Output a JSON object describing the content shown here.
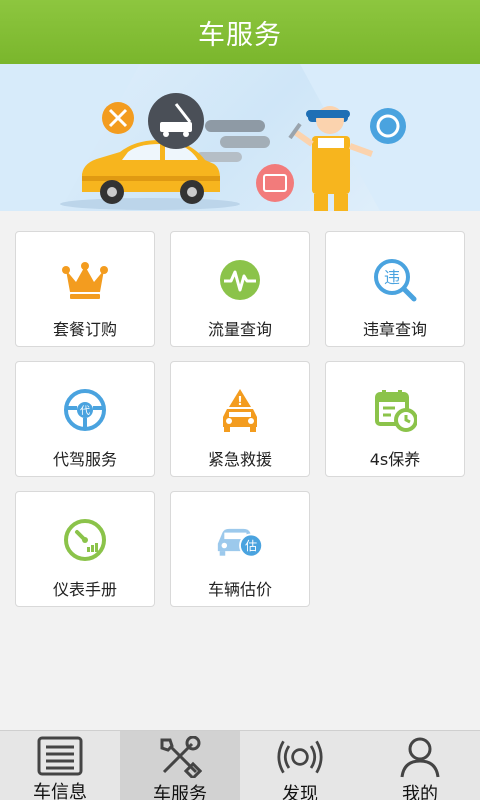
{
  "header": {
    "title": "车服务"
  },
  "services": [
    {
      "label": "套餐订购",
      "icon": "crown-icon"
    },
    {
      "label": "流量查询",
      "icon": "pulse-icon"
    },
    {
      "label": "违章查询",
      "icon": "violation-search-icon",
      "glyph": "违"
    },
    {
      "label": "代驾服务",
      "icon": "steering-wheel-icon",
      "glyph": "代"
    },
    {
      "label": "紧急救援",
      "icon": "emergency-car-icon",
      "glyph": "!"
    },
    {
      "label": "4s保养",
      "icon": "calendar-clock-icon"
    },
    {
      "label": "仪表手册",
      "icon": "gauge-icon"
    },
    {
      "label": "车辆估价",
      "icon": "car-valuation-icon",
      "glyph": "估"
    }
  ],
  "tabs": [
    {
      "label": "车信息",
      "icon": "list-icon"
    },
    {
      "label": "车服务",
      "icon": "tools-icon",
      "active": true
    },
    {
      "label": "发现",
      "icon": "broadcast-icon"
    },
    {
      "label": "我的",
      "icon": "user-icon"
    }
  ],
  "colors": {
    "header": "#7fba30",
    "orange": "#f39c1f",
    "green": "#8bc34a",
    "blue": "#4aa3df"
  }
}
